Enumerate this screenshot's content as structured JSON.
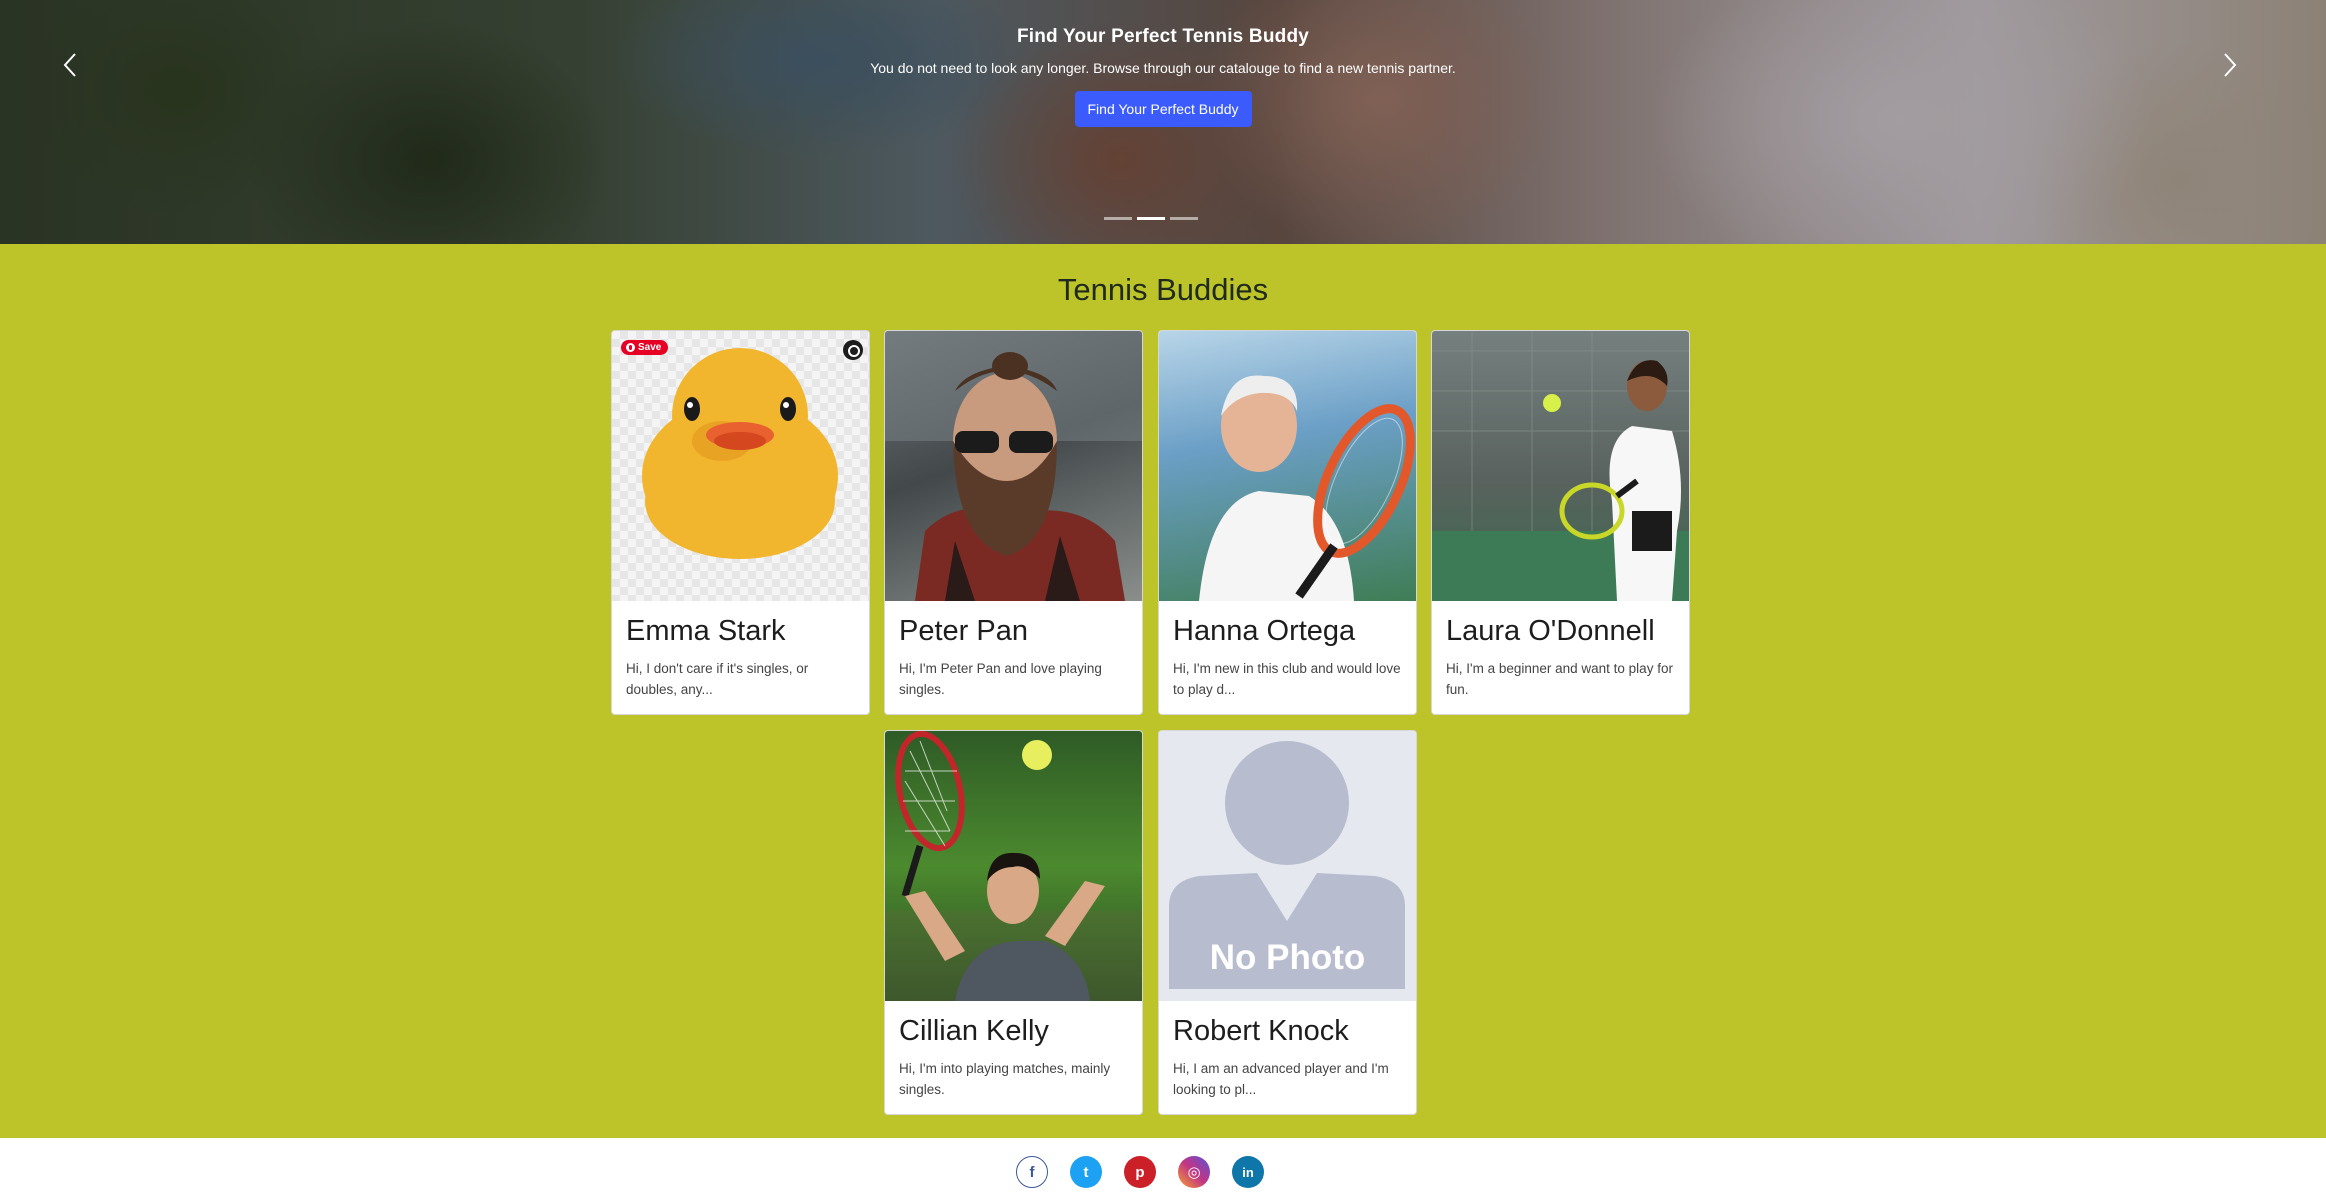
{
  "hero": {
    "title": "Find Your Perfect Tennis Buddy",
    "subtitle": "You do not need to look any longer. Browse through our catalouge to find a new tennis partner.",
    "button_label": "Find Your Perfect Buddy",
    "prev_icon": "chevron-left-icon",
    "next_icon": "chevron-right-icon",
    "indicators": 3,
    "active_indicator": 2
  },
  "main": {
    "title": "Tennis Buddies",
    "background": "#bdc42a",
    "cards": [
      {
        "name": "Emma Stark",
        "description": "Hi, I don't care if it's singles, or doubles, any...",
        "pinterest_save_label": "Save"
      },
      {
        "name": "Peter Pan",
        "description": "Hi, I'm Peter Pan and love playing singles."
      },
      {
        "name": "Hanna Ortega",
        "description": "Hi, I'm new in this club and would love to play d..."
      },
      {
        "name": "Laura O'Donnell",
        "description": "Hi, I'm a beginner and want to play for fun."
      },
      {
        "name": "Cillian Kelly",
        "description": "Hi, I'm into playing matches, mainly singles."
      },
      {
        "name": "Robert Knock",
        "description": "Hi, I am an advanced player and I'm looking to pl...",
        "placeholder_text": "No Photo"
      }
    ]
  },
  "footer": {
    "socials": [
      {
        "name": "facebook",
        "icon": "facebook-icon",
        "glyph": "f",
        "color": "#3b5998"
      },
      {
        "name": "twitter",
        "icon": "twitter-icon",
        "glyph": "t",
        "color": "#1da1f2"
      },
      {
        "name": "pinterest",
        "icon": "pinterest-icon",
        "glyph": "p",
        "color": "#cb2027"
      },
      {
        "name": "instagram",
        "icon": "instagram-icon",
        "glyph": "◎",
        "color": "#c13584"
      },
      {
        "name": "linkedin",
        "icon": "linkedin-icon",
        "glyph": "in",
        "color": "#0e76a8"
      }
    ]
  },
  "colors": {
    "accent": "#3b5bfd",
    "section_bg": "#bdc42a"
  }
}
